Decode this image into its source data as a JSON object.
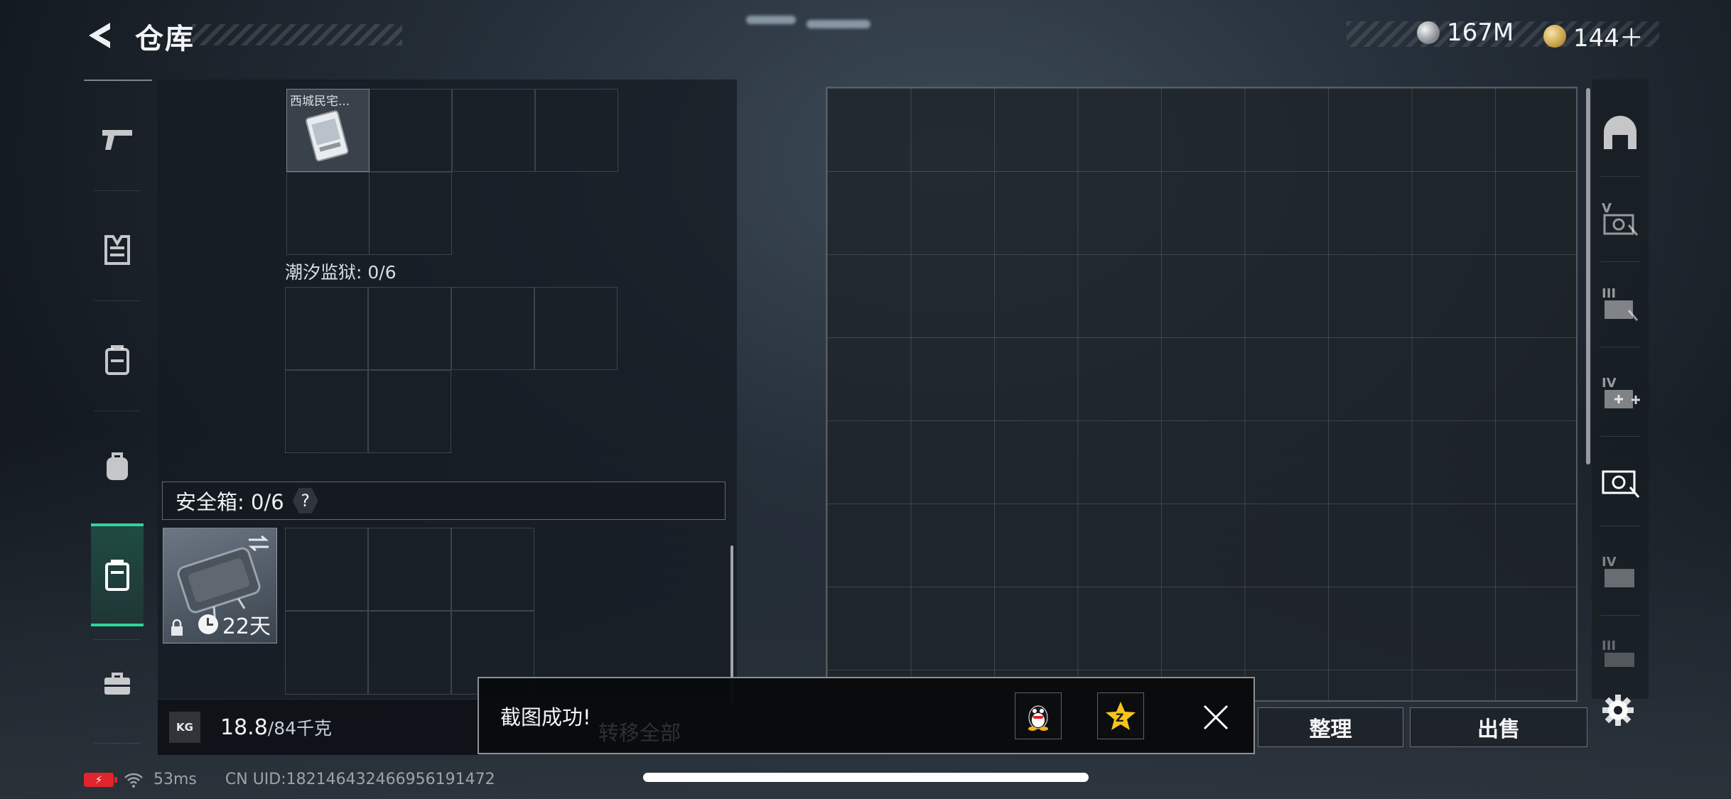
{
  "header": {
    "title": "仓库",
    "silver_amount": "167M",
    "gold_amount": "144＋"
  },
  "left_nav": {
    "items": [
      {
        "icon": "pistol-icon",
        "active": false
      },
      {
        "icon": "armor-vest-icon",
        "active": false
      },
      {
        "icon": "chest-rig-icon",
        "active": false
      },
      {
        "icon": "backpack-icon",
        "active": false
      },
      {
        "icon": "safe-box-icon",
        "active": true
      },
      {
        "icon": "briefcase-icon",
        "active": false
      }
    ]
  },
  "left_panel": {
    "top_item_name": "西城民宅...",
    "tidal_prison_label": "潮汐监狱: 0/6",
    "safe_box_label": "安全箱: 0/6",
    "help_glyph": "?",
    "safe_box_days": "22天",
    "weight_current": "18.8",
    "weight_max": "/84千克",
    "weight_badge": "KG"
  },
  "right_nav": {
    "items": [
      {
        "icon": "arch-gate-icon",
        "glyph": ""
      },
      {
        "icon": "container-v-icon",
        "glyph": "V"
      },
      {
        "icon": "container-iii-icon",
        "glyph": "III"
      },
      {
        "icon": "medical-iv-icon",
        "glyph": "IV"
      },
      {
        "icon": "cash-container-icon",
        "glyph": ""
      },
      {
        "icon": "container-iv-icon",
        "glyph": "IV"
      },
      {
        "icon": "container-iii-b-icon",
        "glyph": "III"
      }
    ]
  },
  "bottom_buttons": {
    "sort_label": "整理",
    "sell_label": "出售",
    "transfer_all_label": "转移全部"
  },
  "toast": {
    "message": "截图成功!",
    "qq_label": "QQ",
    "qzone_label": "Z"
  },
  "status_bar": {
    "ping": "53ms",
    "uid": "CN UID:18214643246695619147​2"
  },
  "colors": {
    "accent_green": "#2fd39a",
    "battery_red": "#e0242b"
  }
}
